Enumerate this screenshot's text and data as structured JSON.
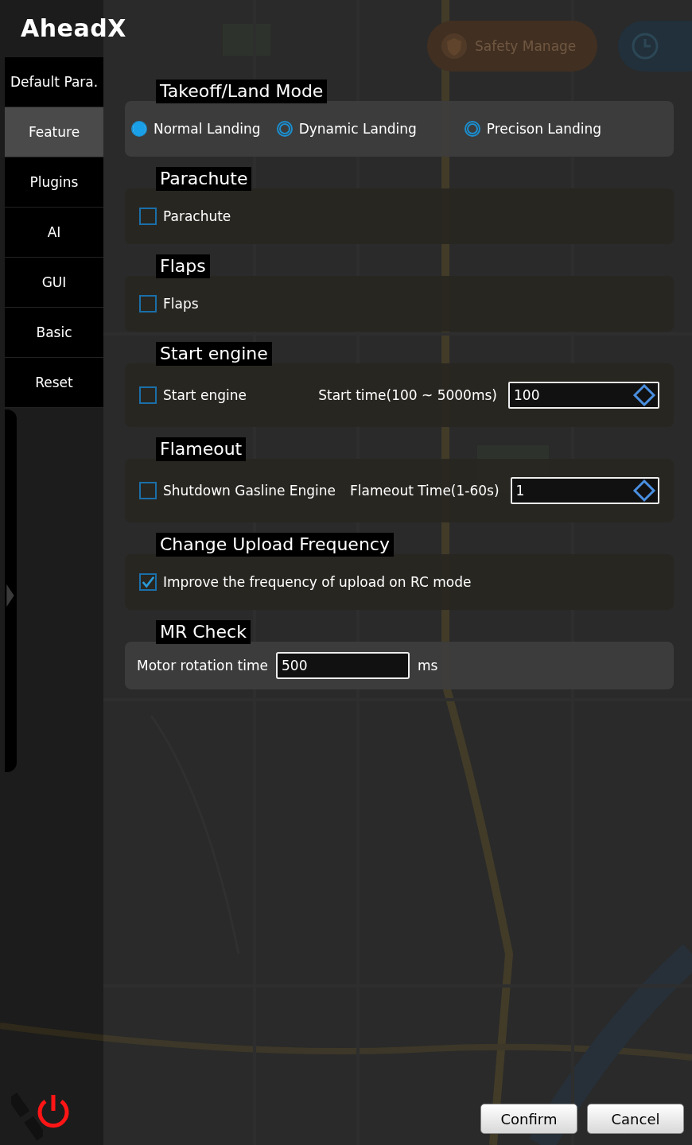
{
  "app": {
    "logo": "AheadX"
  },
  "map_buttons": [
    {
      "kind": "safety",
      "label": "Safety Manage"
    },
    {
      "kind": "clock"
    }
  ],
  "sidebar": {
    "items": [
      {
        "label": "Default Para.",
        "selected": false
      },
      {
        "label": "Feature",
        "selected": true
      },
      {
        "label": "Plugins",
        "selected": false
      },
      {
        "label": "AI",
        "selected": false
      },
      {
        "label": "GUI",
        "selected": false
      },
      {
        "label": "Basic",
        "selected": false
      },
      {
        "label": "Reset",
        "selected": false
      }
    ]
  },
  "sections": [
    {
      "kind": "radios",
      "title": "Takeoff/Land Mode",
      "options": [
        {
          "label": "Normal Landing",
          "selected": true
        },
        {
          "label": "Dynamic Landing",
          "selected": false
        },
        {
          "label": "Precison Landing",
          "selected": false
        }
      ]
    },
    {
      "kind": "checkbox",
      "title": "Parachute",
      "checkbox": {
        "label": "Parachute",
        "checked": false
      }
    },
    {
      "kind": "checkbox",
      "title": "Flaps",
      "checkbox": {
        "label": "Flaps",
        "checked": false
      }
    },
    {
      "kind": "spin",
      "title": "Start engine",
      "checkbox": {
        "label": "Start engine",
        "checked": false
      },
      "field_label": "Start time(100 ~ 5000ms)",
      "value": "100"
    },
    {
      "kind": "spin",
      "title": "Flameout",
      "checkbox": {
        "label": "Shutdown Gasline Engine",
        "checked": false
      },
      "field_label": "Flameout Time(1-60s)",
      "value": "1"
    },
    {
      "kind": "checkbox",
      "title": "Change Upload Frequency",
      "checkbox": {
        "label": "Improve the frequency of upload on RC mode",
        "checked": true
      }
    },
    {
      "kind": "input",
      "title": "MR Check",
      "field_label": "Motor rotation time",
      "value": "500",
      "unit": "ms"
    }
  ],
  "buttons": [
    "Confirm",
    "Cancel"
  ]
}
